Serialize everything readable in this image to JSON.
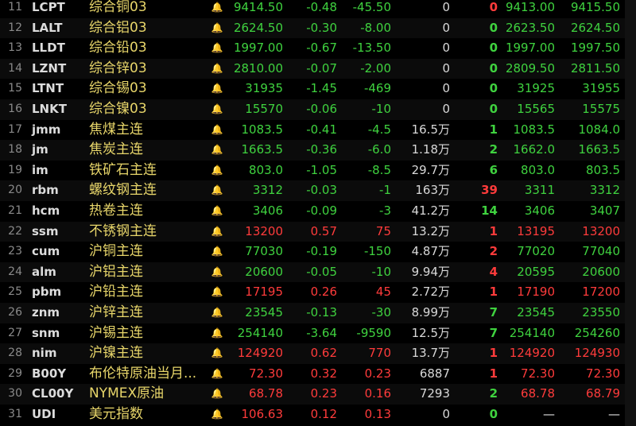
{
  "rows": [
    {
      "idx": "11",
      "code": "LCPT",
      "name": "综合铜03",
      "last": "9414.50",
      "pct": "-0.48",
      "chg": "-45.50",
      "vol": "0",
      "cur": "0",
      "bid": "9413.00",
      "ask": "9415.50",
      "dir": "green",
      "cur_dir": "red"
    },
    {
      "idx": "12",
      "code": "LALT",
      "name": "综合铝03",
      "last": "2624.50",
      "pct": "-0.30",
      "chg": "-8.00",
      "vol": "0",
      "cur": "0",
      "bid": "2623.50",
      "ask": "2624.50",
      "dir": "green",
      "cur_dir": "green"
    },
    {
      "idx": "13",
      "code": "LLDT",
      "name": "综合铅03",
      "last": "1997.00",
      "pct": "-0.67",
      "chg": "-13.50",
      "vol": "0",
      "cur": "0",
      "bid": "1997.00",
      "ask": "1997.50",
      "dir": "green",
      "cur_dir": "green"
    },
    {
      "idx": "14",
      "code": "LZNT",
      "name": "综合锌03",
      "last": "2810.00",
      "pct": "-0.07",
      "chg": "-2.00",
      "vol": "0",
      "cur": "0",
      "bid": "2809.50",
      "ask": "2811.50",
      "dir": "green",
      "cur_dir": "green"
    },
    {
      "idx": "15",
      "code": "LTNT",
      "name": "综合锡03",
      "last": "31935",
      "pct": "-1.45",
      "chg": "-469",
      "vol": "0",
      "cur": "0",
      "bid": "31925",
      "ask": "31955",
      "dir": "green",
      "cur_dir": "green"
    },
    {
      "idx": "16",
      "code": "LNKT",
      "name": "综合镍03",
      "last": "15570",
      "pct": "-0.06",
      "chg": "-10",
      "vol": "0",
      "cur": "0",
      "bid": "15565",
      "ask": "15575",
      "dir": "green",
      "cur_dir": "green"
    },
    {
      "idx": "17",
      "code": "jmm",
      "name": "焦煤主连",
      "last": "1083.5",
      "pct": "-0.41",
      "chg": "-4.5",
      "vol": "16.5万",
      "cur": "1",
      "bid": "1083.5",
      "ask": "1084.0",
      "dir": "green",
      "cur_dir": "green"
    },
    {
      "idx": "18",
      "code": "jm",
      "name": "焦炭主连",
      "last": "1663.5",
      "pct": "-0.36",
      "chg": "-6.0",
      "vol": "1.18万",
      "cur": "2",
      "bid": "1662.0",
      "ask": "1663.5",
      "dir": "green",
      "cur_dir": "green"
    },
    {
      "idx": "19",
      "code": "im",
      "name": "铁矿石主连",
      "last": "803.0",
      "pct": "-1.05",
      "chg": "-8.5",
      "vol": "29.7万",
      "cur": "6",
      "bid": "803.0",
      "ask": "803.5",
      "dir": "green",
      "cur_dir": "green"
    },
    {
      "idx": "20",
      "code": "rbm",
      "name": "螺纹钢主连",
      "last": "3312",
      "pct": "-0.03",
      "chg": "-1",
      "vol": "163万",
      "cur": "39",
      "bid": "3311",
      "ask": "3312",
      "dir": "green",
      "cur_dir": "red"
    },
    {
      "idx": "21",
      "code": "hcm",
      "name": "热卷主连",
      "last": "3406",
      "pct": "-0.09",
      "chg": "-3",
      "vol": "41.2万",
      "cur": "14",
      "bid": "3406",
      "ask": "3407",
      "dir": "green",
      "cur_dir": "green"
    },
    {
      "idx": "22",
      "code": "ssm",
      "name": "不锈钢主连",
      "last": "13200",
      "pct": "0.57",
      "chg": "75",
      "vol": "13.2万",
      "cur": "1",
      "bid": "13195",
      "ask": "13200",
      "dir": "red",
      "cur_dir": "red"
    },
    {
      "idx": "23",
      "code": "cum",
      "name": "沪铜主连",
      "last": "77030",
      "pct": "-0.19",
      "chg": "-150",
      "vol": "4.87万",
      "cur": "2",
      "bid": "77020",
      "ask": "77040",
      "dir": "green",
      "cur_dir": "red"
    },
    {
      "idx": "24",
      "code": "alm",
      "name": "沪铝主连",
      "last": "20600",
      "pct": "-0.05",
      "chg": "-10",
      "vol": "9.94万",
      "cur": "4",
      "bid": "20595",
      "ask": "20600",
      "dir": "green",
      "cur_dir": "red"
    },
    {
      "idx": "25",
      "code": "pbm",
      "name": "沪铅主连",
      "last": "17195",
      "pct": "0.26",
      "chg": "45",
      "vol": "2.72万",
      "cur": "1",
      "bid": "17190",
      "ask": "17200",
      "dir": "red",
      "cur_dir": "red"
    },
    {
      "idx": "26",
      "code": "znm",
      "name": "沪锌主连",
      "last": "23545",
      "pct": "-0.13",
      "chg": "-30",
      "vol": "8.99万",
      "cur": "7",
      "bid": "23545",
      "ask": "23550",
      "dir": "green",
      "cur_dir": "green"
    },
    {
      "idx": "27",
      "code": "snm",
      "name": "沪锡主连",
      "last": "254140",
      "pct": "-3.64",
      "chg": "-9590",
      "vol": "12.5万",
      "cur": "7",
      "bid": "254140",
      "ask": "254260",
      "dir": "green",
      "cur_dir": "green"
    },
    {
      "idx": "28",
      "code": "nim",
      "name": "沪镍主连",
      "last": "124920",
      "pct": "0.62",
      "chg": "770",
      "vol": "13.7万",
      "cur": "1",
      "bid": "124920",
      "ask": "124930",
      "dir": "red",
      "cur_dir": "red"
    },
    {
      "idx": "29",
      "code": "B00Y",
      "name": "布伦特原油当月...",
      "last": "72.30",
      "pct": "0.32",
      "chg": "0.23",
      "vol": "6887",
      "cur": "1",
      "bid": "72.30",
      "ask": "72.30",
      "dir": "red",
      "cur_dir": "red"
    },
    {
      "idx": "30",
      "code": "CL00Y",
      "name": "NYMEX原油",
      "last": "68.78",
      "pct": "0.23",
      "chg": "0.16",
      "vol": "7293",
      "cur": "2",
      "bid": "68.78",
      "ask": "68.79",
      "dir": "red",
      "cur_dir": "green"
    },
    {
      "idx": "31",
      "code": "UDI",
      "name": "美元指数",
      "last": "106.63",
      "pct": "0.12",
      "chg": "0.13",
      "vol": "0",
      "cur": "0",
      "bid": "—",
      "ask": "—",
      "dir": "red",
      "cur_dir": "green"
    }
  ],
  "icons": {
    "alert": "bell-icon"
  },
  "colors": {
    "up": "#ff3b3b",
    "down": "#3fd23f",
    "name": "#e8d66a",
    "background": "#000000"
  }
}
